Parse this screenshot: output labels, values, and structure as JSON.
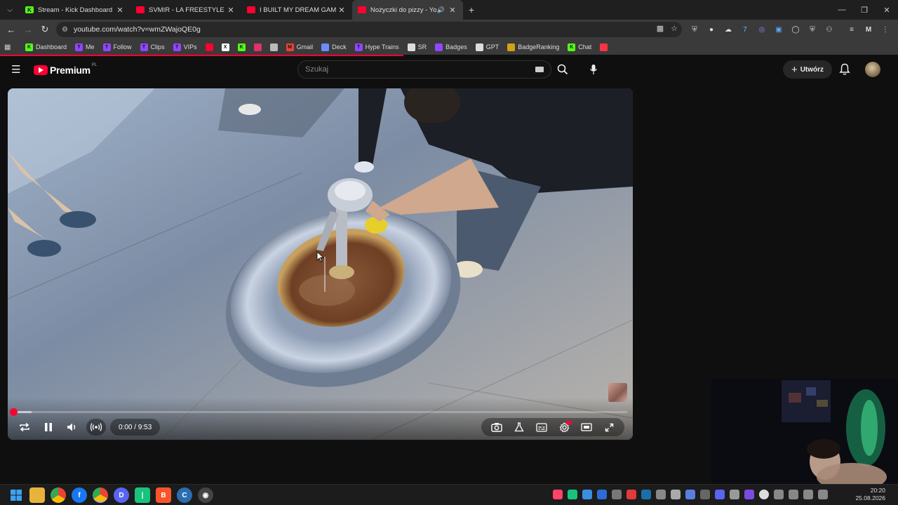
{
  "browser": {
    "tabs": [
      {
        "title": "Stream - Kick Dashboard",
        "favicon_color": "#53fc18",
        "favicon_letter": "K",
        "active": false
      },
      {
        "title": "SVMIR - LA FREESTYLE - YouTube",
        "favicon_color": "#ff0033",
        "favicon_letter": "",
        "active": false
      },
      {
        "title": "I BUILT MY DREAM GAMING RO",
        "favicon_color": "#ff0033",
        "favicon_letter": "",
        "active": false
      },
      {
        "title": "Nożyczki do pizzy - YouTube",
        "favicon_color": "#ff0033",
        "favicon_letter": "",
        "active": true
      }
    ],
    "url": "youtube.com/watch?v=wmZWajoQE0g",
    "bookmarks": [
      {
        "label": "Dashboard",
        "icon": "kick-icon",
        "color": "#53fc18",
        "letter": "K"
      },
      {
        "label": "Me",
        "icon": "twitch-icon",
        "color": "#9146ff",
        "letter": "T"
      },
      {
        "label": "Follow",
        "icon": "twitch-icon",
        "color": "#9146ff",
        "letter": "T"
      },
      {
        "label": "Clips",
        "icon": "twitch-icon",
        "color": "#9146ff",
        "letter": "T"
      },
      {
        "label": "VIPs",
        "icon": "twitch-icon",
        "color": "#9146ff",
        "letter": "T"
      },
      {
        "label": "",
        "icon": "youtube-icon",
        "color": "#ff0033",
        "letter": ""
      },
      {
        "label": "",
        "icon": "x-icon",
        "color": "#ffffff",
        "letter": "X"
      },
      {
        "label": "",
        "icon": "kick-icon",
        "color": "#53fc18",
        "letter": "K"
      },
      {
        "label": "",
        "icon": "instagram-icon",
        "color": "#e1306c",
        "letter": ""
      },
      {
        "label": "",
        "icon": "grid-icon",
        "color": "#bbbbbb",
        "letter": ""
      },
      {
        "label": "Gmail",
        "icon": "gmail-icon",
        "color": "#ea4335",
        "letter": "M"
      },
      {
        "label": "Deck",
        "icon": "deck-icon",
        "color": "#6b8cff",
        "letter": ""
      },
      {
        "label": "Hype Trains",
        "icon": "twitch-icon",
        "color": "#9146ff",
        "letter": "T"
      },
      {
        "label": "SR",
        "icon": "anchor-icon",
        "color": "#dddddd",
        "letter": ""
      },
      {
        "label": "Badges",
        "icon": "badge-icon",
        "color": "#9146ff",
        "letter": ""
      },
      {
        "label": "GPT",
        "icon": "openai-icon",
        "color": "#dddddd",
        "letter": ""
      },
      {
        "label": "BadgeRanking",
        "icon": "ranking-icon",
        "color": "#d4a017",
        "letter": ""
      },
      {
        "label": "Chat",
        "icon": "kick-icon",
        "color": "#53fc18",
        "letter": "K"
      },
      {
        "label": "",
        "icon": "arrow-icon",
        "color": "#ff3344",
        "letter": ""
      }
    ]
  },
  "youtube": {
    "logo_text": "Premium",
    "country_code": "PL",
    "search_placeholder": "Szukaj",
    "create_label": "Utwórz",
    "accent": "#ff0033"
  },
  "player": {
    "time_display": "0:00 / 9:53",
    "played_fraction": 0.0,
    "buffered_fraction": 0.03
  },
  "taskbar": {
    "time": "20:20",
    "date": "25.08.2026"
  }
}
